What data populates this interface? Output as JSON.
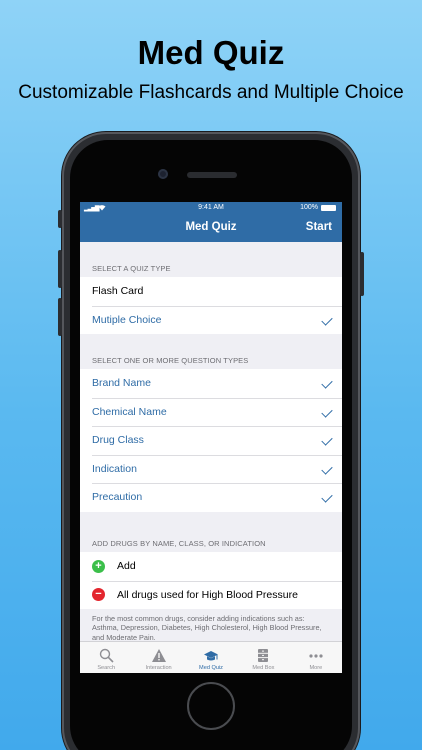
{
  "marketing": {
    "title": "Med Quiz",
    "subtitle": "Customizable Flashcards and Multiple Choice"
  },
  "status_bar": {
    "time": "9:41 AM",
    "battery": "100%"
  },
  "nav": {
    "title": "Med Quiz",
    "start_label": "Start"
  },
  "quiz_type": {
    "header": "SELECT A QUIZ TYPE",
    "options": [
      {
        "label": "Flash Card",
        "selected": false
      },
      {
        "label": "Mutiple Choice",
        "selected": true
      }
    ]
  },
  "question_types": {
    "header": "SELECT ONE OR MORE QUESTION TYPES",
    "options": [
      {
        "label": "Brand Name",
        "selected": true
      },
      {
        "label": "Chemical Name",
        "selected": true
      },
      {
        "label": "Drug Class",
        "selected": true
      },
      {
        "label": "Indication",
        "selected": true
      },
      {
        "label": "Precaution",
        "selected": true
      }
    ]
  },
  "add_drugs": {
    "header": "ADD DRUGS BY NAME, CLASS, OR INDICATION",
    "add_label": "Add",
    "items": [
      {
        "label": "All drugs used for High Blood Pressure"
      }
    ],
    "footnote": "For the most common drugs, consider adding indications such as: Asthma, Depression, Diabetes, High Cholesterol, High Blood Pressure, and Moderate Pain."
  },
  "tabs": [
    {
      "label": "Search",
      "icon": "search-icon",
      "active": false
    },
    {
      "label": "Interaction",
      "icon": "warning-icon",
      "active": false
    },
    {
      "label": "Med Quiz",
      "icon": "graduation-cap-icon",
      "active": true
    },
    {
      "label": "Med Box",
      "icon": "cabinet-icon",
      "active": false
    },
    {
      "label": "More",
      "icon": "more-icon",
      "active": false
    }
  ],
  "colors": {
    "accent": "#2f6ca6",
    "add": "#3bbf4a",
    "remove": "#e3262e"
  }
}
